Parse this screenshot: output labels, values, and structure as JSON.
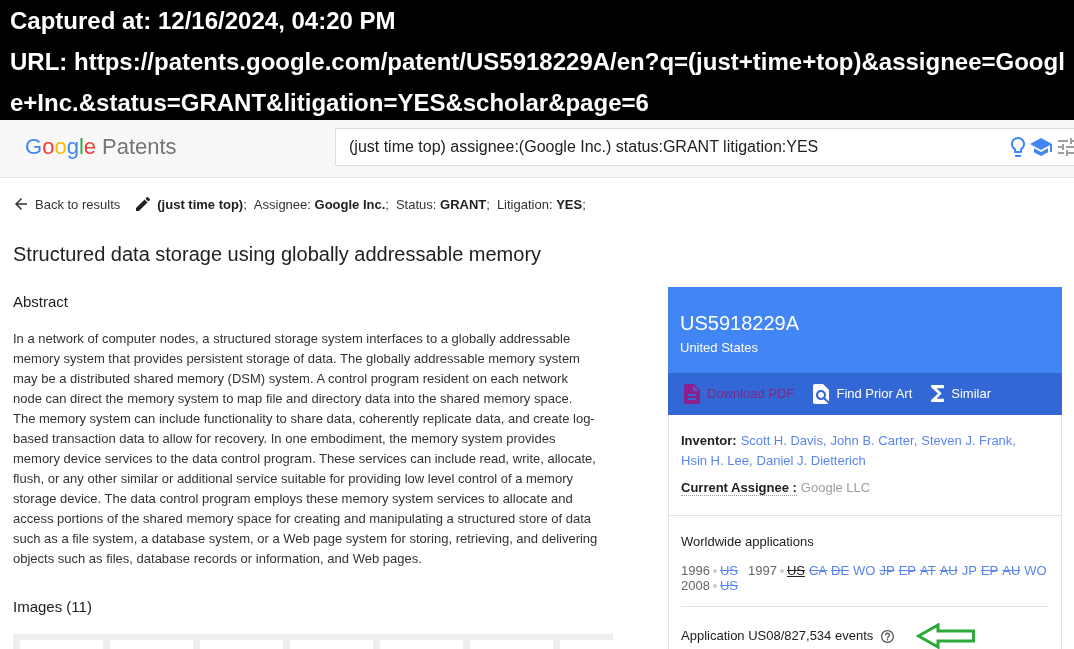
{
  "capture_banner": {
    "captured_at": "Captured at: 12/16/2024, 04:20 PM",
    "url": "URL: https://patents.google.com/patent/US5918229A/en?q=(just+time+top)&assignee=Google+Inc.&status=GRANT&litigation=YES&scholar&page=6"
  },
  "header": {
    "logo": {
      "brand": "Google",
      "product": "Patents"
    },
    "search": {
      "value": "(just time top) assignee:(Google Inc.) status:GRANT litigation:YES"
    }
  },
  "breadcrumb": {
    "back_link": "Back to results",
    "filters": [
      "**(just time top)**;",
      "Assignee: **Google Inc.**;",
      "Status: **GRANT**;",
      "Litigation: **YES**;"
    ]
  },
  "title": "Structured data storage using globally addressable memory",
  "abstract": {
    "heading": "Abstract",
    "text": "In a network of computer nodes, a structured storage system interfaces to a globally addressable memory system that provides persistent storage of data. The globally addressable memory system may be a distributed shared memory (DSM) system. A control program resident on each network node can direct the memory system to map file and directory data into the shared memory space. The memory system can include functionality to share data, coherently replicate data, and create log-based transaction data to allow for recovery. In one embodiment, the memory system provides memory device services to the data control program. These services can include read, write, allocate, flush, or any other similar or additional service suitable for providing low level control of a memory storage device. The data control program employs these memory system services to allocate and access portions of the shared memory space for creating and manipulating a structured store of data such as a file system, a database system, or a Web page system for storing, retrieving, and delivering objects such as files, database records or information, and Web pages."
  },
  "images": {
    "heading": "Images (11)"
  },
  "summary_panel": {
    "publication_number": "US5918229A",
    "country": "United States",
    "actions": [
      {
        "kind": "pdf",
        "label": "Download PDF",
        "visited": true
      },
      {
        "kind": "prior-art",
        "label": "Find Prior Art",
        "visited": false
      },
      {
        "kind": "similar",
        "label": "Similar",
        "visited": false
      }
    ],
    "inventor_label": "Inventor:",
    "inventors": [
      "Scott H. Davis,",
      "John B. Carter,",
      "Steven J. Frank,",
      "Hsin H. Lee,",
      "Daniel J. Dietterich"
    ],
    "assignee_label": "Current Assignee :",
    "assignee": "Google LLC",
    "worldwide": {
      "heading": "Worldwide applications",
      "years": [
        {
          "year": "1996",
          "applications": [
            {
              "code": "US",
              "inactive": true,
              "current": false
            }
          ]
        },
        {
          "year": "1997",
          "applications": [
            {
              "code": "US",
              "inactive": true,
              "current": true
            },
            {
              "code": "CA",
              "inactive": true,
              "current": false
            },
            {
              "code": "DE",
              "inactive": true,
              "current": false
            },
            {
              "code": "WO",
              "inactive": false,
              "current": false
            },
            {
              "code": "JP",
              "inactive": true,
              "current": false
            },
            {
              "code": "EP",
              "inactive": true,
              "current": false
            },
            {
              "code": "AT",
              "inactive": true,
              "current": false
            },
            {
              "code": "AU",
              "inactive": true,
              "current": false
            },
            {
              "code": "JP",
              "inactive": false,
              "current": false
            },
            {
              "code": "EP",
              "inactive": true,
              "current": false
            },
            {
              "code": "AU",
              "inactive": true,
              "current": false
            },
            {
              "code": "WO",
              "inactive": false,
              "current": false
            }
          ]
        },
        {
          "year": "2008",
          "applications": [
            {
              "code": "US",
              "inactive": true,
              "current": false
            }
          ]
        }
      ]
    },
    "application_events": "Application US08/827,534 events"
  }
}
